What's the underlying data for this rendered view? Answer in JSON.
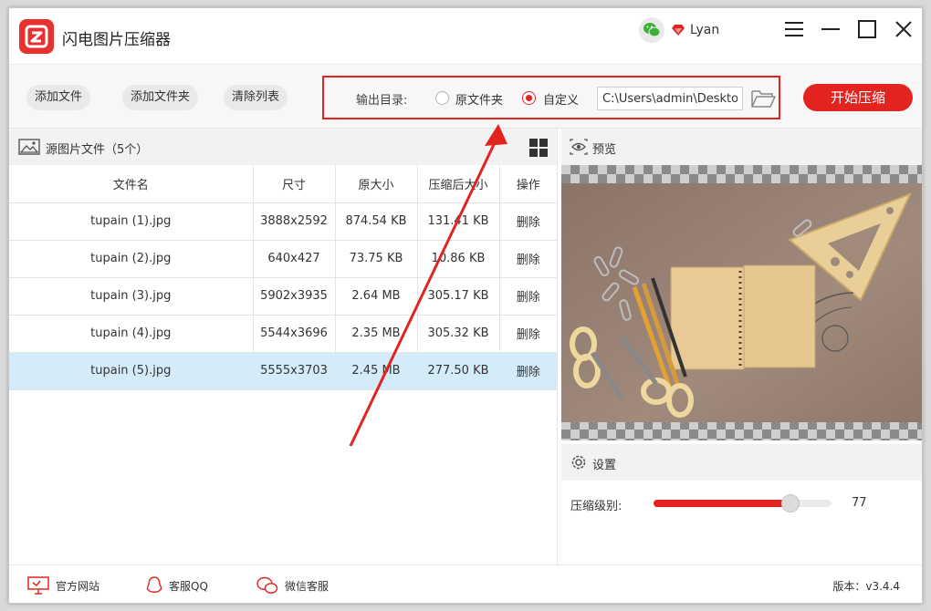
{
  "app": {
    "title": "闪电图片压缩器",
    "username": "Lyan"
  },
  "toolbar": {
    "add_file": "添加文件",
    "add_folder": "添加文件夹",
    "clear_list": "清除列表",
    "output_label": "输出目录:",
    "opt_original": "原文件夹",
    "opt_custom": "自定义",
    "selected_option": "自定义",
    "path_value": "C:\\Users\\admin\\Desktop",
    "start": "开始压缩"
  },
  "source": {
    "title": "源图片文件（5个）",
    "columns": [
      "文件名",
      "尺寸",
      "原大小",
      "压缩后大小",
      "操作"
    ],
    "rows": [
      {
        "name": "tupain (1).jpg",
        "size": "3888x2592",
        "orig": "874.54 KB",
        "comp": "131.41 KB",
        "action": "删除"
      },
      {
        "name": "tupain (2).jpg",
        "size": "640x427",
        "orig": "73.75 KB",
        "comp": "10.86 KB",
        "action": "删除"
      },
      {
        "name": "tupain (3).jpg",
        "size": "5902x3935",
        "orig": "2.64 MB",
        "comp": "305.17 KB",
        "action": "删除"
      },
      {
        "name": "tupain (4).jpg",
        "size": "5544x3696",
        "orig": "2.35 MB",
        "comp": "305.32 KB",
        "action": "删除"
      },
      {
        "name": "tupain (5).jpg",
        "size": "5555x3703",
        "orig": "2.45 MB",
        "comp": "277.50 KB",
        "action": "删除"
      }
    ],
    "selected_row": 4
  },
  "preview": {
    "title": "预览"
  },
  "settings": {
    "title": "设置",
    "level_label": "压缩级别:",
    "level_value": "77",
    "level_fraction": 0.77
  },
  "footer": {
    "website": "官方网站",
    "qq": "客服QQ",
    "wechat": "微信客服",
    "version": "版本：v3.4.4"
  },
  "colors": {
    "accent": "#e3231f",
    "selected_row": "#d4ecfa"
  }
}
